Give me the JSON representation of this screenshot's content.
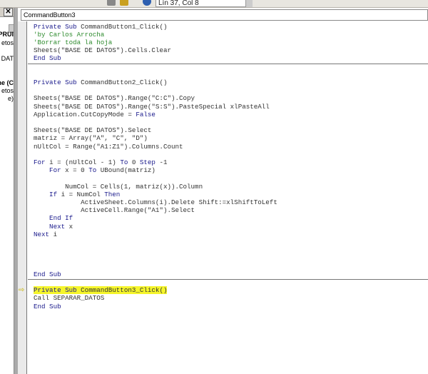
{
  "toolbar": {
    "position": "Lín 37, Col 8"
  },
  "left_pane": {
    "close": "✕",
    "items": [
      "PRUI",
      "etos",
      "DAT",
      "ne (C",
      "etos",
      "e)"
    ]
  },
  "editor": {
    "object_combo": "CommandButton3",
    "current_line": 46,
    "separators_after": [
      4,
      31
    ],
    "lines": [
      [
        [
          "kw",
          "Private Sub "
        ],
        [
          "tx",
          "CommandButton1_Click()"
        ]
      ],
      [
        [
          "cm",
          "'by Carlos Arrocha"
        ]
      ],
      [
        [
          "cm",
          "'Borrar toda la hoja"
        ]
      ],
      [
        [
          "tx",
          "Sheets(\"BASE DE DATOS\").Cells.Clear"
        ]
      ],
      [
        [
          "kw",
          "End Sub"
        ]
      ],
      [],
      [],
      [
        [
          "kw",
          "Private Sub "
        ],
        [
          "tx",
          "CommandButton2_Click()"
        ]
      ],
      [],
      [
        [
          "tx",
          "Sheets(\"BASE DE DATOS\").Range(\"C:C\").Copy"
        ]
      ],
      [
        [
          "tx",
          "Sheets(\"BASE DE DATOS\").Range(\"S:S\").PasteSpecial xlPasteAll"
        ]
      ],
      [
        [
          "tx",
          "Application.CutCopyMode = "
        ],
        [
          "kw",
          "False"
        ]
      ],
      [],
      [
        [
          "tx",
          "Sheets(\"BASE DE DATOS\").Select"
        ]
      ],
      [
        [
          "tx",
          "matriz = Array(\"A\", \"C\", \"D\")"
        ]
      ],
      [
        [
          "tx",
          "nUltCol = Range(\"A1:Z1\").Columns.Count"
        ]
      ],
      [],
      [
        [
          "kw",
          "For "
        ],
        [
          "tx",
          "i = (nUltCol - 1) "
        ],
        [
          "kw",
          "To "
        ],
        [
          "tx",
          "0 "
        ],
        [
          "kw",
          "Step "
        ],
        [
          "tx",
          "-1"
        ]
      ],
      [
        [
          "kw",
          "    For "
        ],
        [
          "tx",
          "x = 0 "
        ],
        [
          "kw",
          "To "
        ],
        [
          "tx",
          "UBound(matriz)"
        ]
      ],
      [],
      [
        [
          "tx",
          "        NumCol = Cells(1, matriz(x)).Column"
        ]
      ],
      [
        [
          "kw",
          "    If "
        ],
        [
          "tx",
          "i = NumCol "
        ],
        [
          "kw",
          "Then"
        ]
      ],
      [
        [
          "tx",
          "            ActiveSheet.Columns(i).Delete Shift:=xlShiftToLeft"
        ]
      ],
      [
        [
          "tx",
          "            ActiveCell.Range(\"A1\").Select"
        ]
      ],
      [
        [
          "kw",
          "    End If"
        ]
      ],
      [
        [
          "kw",
          "    Next "
        ],
        [
          "tx",
          "x"
        ]
      ],
      [
        [
          "kw",
          "Next "
        ],
        [
          "tx",
          "i"
        ]
      ],
      [],
      [],
      [],
      [],
      [
        [
          "kw",
          "End Sub"
        ]
      ],
      [],
      [
        [
          "kw",
          "Private Sub "
        ],
        [
          "tx",
          "CommandButton3_Click()"
        ]
      ],
      [
        [
          "tx",
          "Call SEPARAR_DATOS"
        ]
      ],
      [
        [
          "kw",
          "End Sub"
        ]
      ]
    ],
    "highlight_index": 33
  }
}
